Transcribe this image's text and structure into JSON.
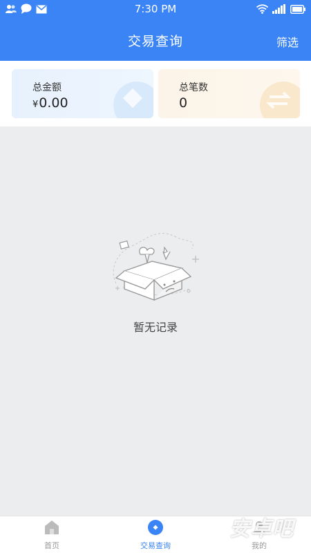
{
  "status_bar": {
    "time": "7:30 PM",
    "icons": [
      "contacts-icon",
      "message-icon",
      "mail-icon",
      "wifi-icon",
      "signal-icon",
      "battery-icon"
    ]
  },
  "header": {
    "title": "交易查询",
    "filter_label": "筛选"
  },
  "summary": {
    "amount_label": "总金额",
    "amount_currency": "¥",
    "amount_value": "0.00",
    "count_label": "总笔数",
    "count_value": "0"
  },
  "empty_state": {
    "text": "暂无记录",
    "icon": "empty-box-icon"
  },
  "bottom_nav": {
    "items": [
      {
        "label": "首页",
        "icon": "home-icon",
        "active": false
      },
      {
        "label": "交易查询",
        "icon": "transaction-icon",
        "active": true
      },
      {
        "label": "我的",
        "icon": "user-icon",
        "active": false
      }
    ]
  },
  "watermark": "安卓吧",
  "colors": {
    "primary": "#3a84f6",
    "background": "#ebedee",
    "inactive_nav": "#999999"
  }
}
